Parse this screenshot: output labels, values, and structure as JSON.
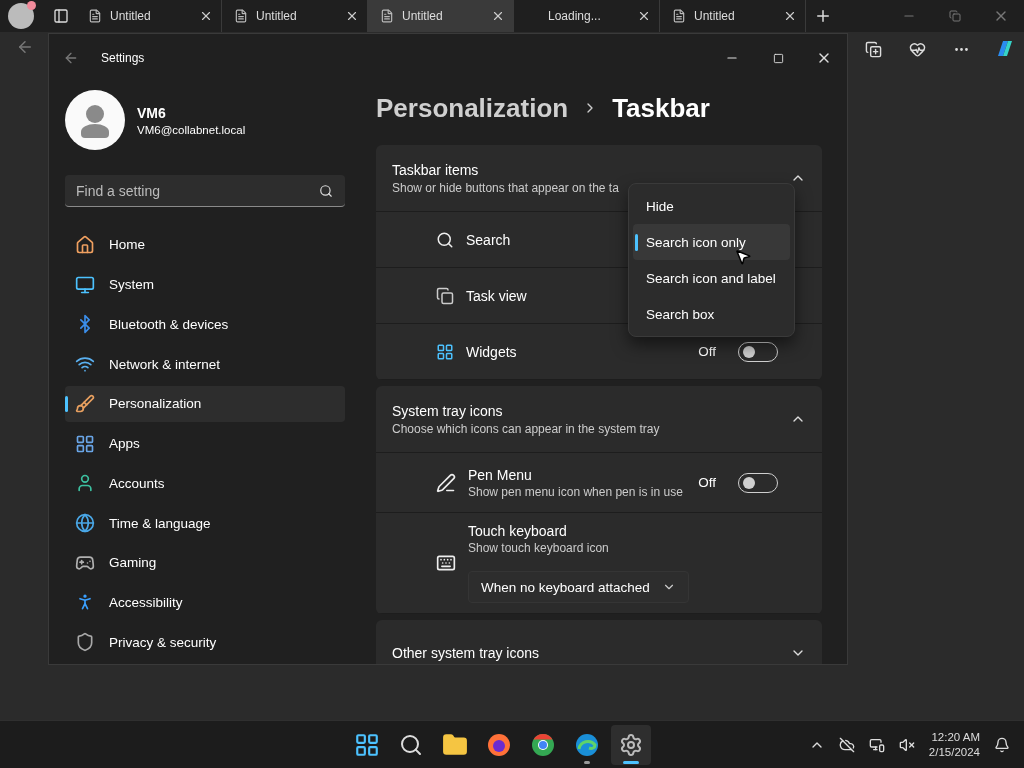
{
  "browser": {
    "tabs": [
      {
        "title": "Untitled",
        "selected": false,
        "loading": false
      },
      {
        "title": "Untitled",
        "selected": false,
        "loading": false
      },
      {
        "title": "Untitled",
        "selected": true,
        "loading": false
      },
      {
        "title": "Loading...",
        "selected": false,
        "loading": true
      },
      {
        "title": "Untitled",
        "selected": false,
        "loading": false
      }
    ]
  },
  "settings": {
    "title": "Settings",
    "user": {
      "name": "VM6",
      "email": "VM6@collabnet.local"
    },
    "search": {
      "placeholder": "Find a setting"
    },
    "nav": [
      {
        "label": "Home",
        "kind": "home",
        "selected": false
      },
      {
        "label": "System",
        "kind": "system",
        "selected": false
      },
      {
        "label": "Bluetooth & devices",
        "kind": "bluetooth",
        "selected": false
      },
      {
        "label": "Network & internet",
        "kind": "network",
        "selected": false
      },
      {
        "label": "Personalization",
        "kind": "personalization",
        "selected": true
      },
      {
        "label": "Apps",
        "kind": "apps",
        "selected": false
      },
      {
        "label": "Accounts",
        "kind": "accounts",
        "selected": false
      },
      {
        "label": "Time & language",
        "kind": "time",
        "selected": false
      },
      {
        "label": "Gaming",
        "kind": "gaming",
        "selected": false
      },
      {
        "label": "Accessibility",
        "kind": "accessibility",
        "selected": false
      },
      {
        "label": "Privacy & security",
        "kind": "privacy",
        "selected": false
      }
    ],
    "breadcrumb": [
      "Personalization",
      "Taskbar"
    ],
    "sections": [
      {
        "title": "Taskbar items",
        "subtitle": "Show or hide buttons that appear on the ta",
        "expanded": true,
        "items": [
          {
            "kind": "search",
            "label": "Search"
          },
          {
            "kind": "taskview",
            "label": "Task view"
          },
          {
            "kind": "widgets",
            "label": "Widgets",
            "state": "Off",
            "on": false
          }
        ]
      },
      {
        "title": "System tray icons",
        "subtitle": "Choose which icons can appear in the system tray",
        "expanded": true,
        "items": [
          {
            "kind": "pen",
            "label": "Pen Menu",
            "description": "Show pen menu icon when pen is in use",
            "state": "Off",
            "on": false
          },
          {
            "kind": "keyboard",
            "label": "Touch keyboard",
            "description": "Show touch keyboard icon",
            "value": "When no keyboard attached"
          }
        ]
      },
      {
        "title": "Other system tray icons",
        "expanded": false
      }
    ],
    "menu": [
      {
        "label": "Hide",
        "selected": false
      },
      {
        "label": "Search icon only",
        "selected": true
      },
      {
        "label": "Search icon and label",
        "selected": false
      },
      {
        "label": "Search box",
        "selected": false
      }
    ]
  },
  "taskbar": {
    "apps": [
      {
        "kind": "start",
        "running": false,
        "selected": false
      },
      {
        "kind": "search",
        "running": false,
        "selected": false
      },
      {
        "kind": "files",
        "running": false,
        "selected": false
      },
      {
        "kind": "firefox",
        "running": false,
        "selected": false
      },
      {
        "kind": "chrome",
        "running": false,
        "selected": false
      },
      {
        "kind": "edge",
        "running": true,
        "selected": false
      },
      {
        "kind": "settings",
        "running": true,
        "selected": true
      }
    ],
    "time": "12:20 AM",
    "date": "2/15/2024"
  }
}
